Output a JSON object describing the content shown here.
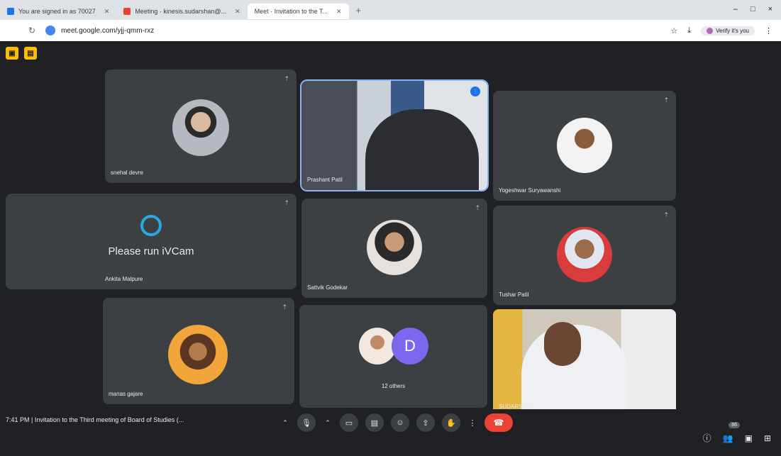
{
  "browser": {
    "tabs": [
      {
        "label": "You are signed in as 70027",
        "icon": "doc-icon",
        "active": false
      },
      {
        "label": "Meeting · kinesis.sudarshan@...",
        "icon": "mail-icon",
        "active": false
      },
      {
        "label": "Meet · Invitation to the T...",
        "icon": "meet-icon",
        "active": true
      }
    ],
    "new_tab": "+",
    "url": "meet.google.com/yjj-qmm-rxz",
    "profile_label": "Verify it's you",
    "window_controls": {
      "minimize": "–",
      "maximize": "□",
      "close": "×"
    }
  },
  "participants": [
    {
      "name": "snehal devre",
      "type": "avatar"
    },
    {
      "name": "Prashant Patil",
      "type": "video",
      "speaking": true
    },
    {
      "name": "Yogeshwar Suryawanshi",
      "type": "avatar"
    },
    {
      "name": "Ankita Malpure",
      "type": "ivcam",
      "message": "Please run iVCam"
    },
    {
      "name": "Sattvik Godekar",
      "type": "avatar"
    },
    {
      "name": "Tushar Patil",
      "type": "avatar"
    },
    {
      "name": "manas gajare",
      "type": "avatar"
    },
    {
      "name": "",
      "type": "others",
      "initial": "D",
      "count_label": "12 others"
    },
    {
      "name": "SUDARSHAN",
      "type": "video"
    }
  ],
  "bottom": {
    "meeting_info": "7:41 PM  |  Invitation to the Third meeting of Board of Studies (...",
    "right_badge": "86"
  },
  "colors": {
    "end_call": "#ea4335",
    "speaking_outline": "#8ab4f8",
    "tile_bg": "#3c4043"
  }
}
